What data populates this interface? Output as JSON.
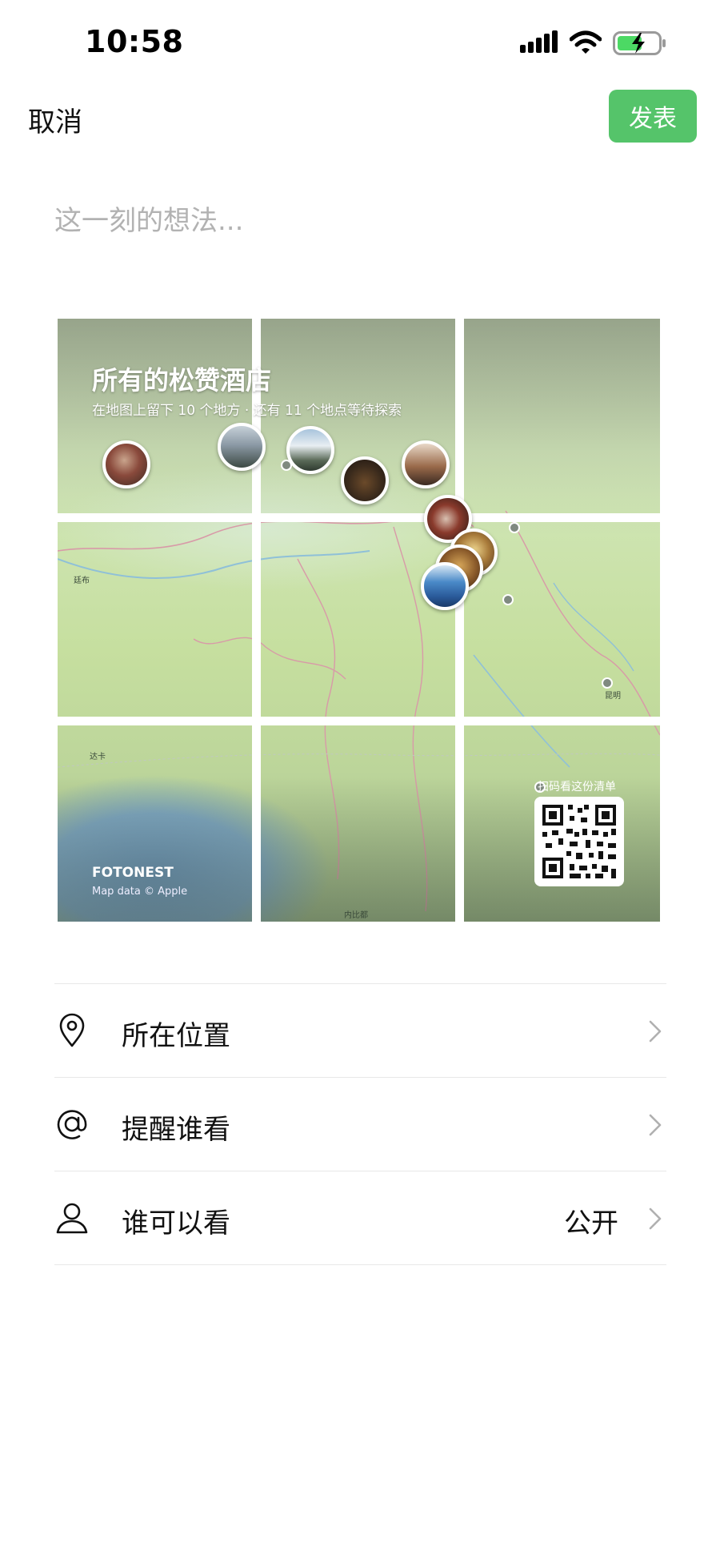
{
  "status_bar": {
    "time": "10:58"
  },
  "header": {
    "cancel_label": "取消",
    "publish_label": "发表"
  },
  "composer": {
    "placeholder": "这一刻的想法..."
  },
  "map_card": {
    "title": "所有的松赞酒店",
    "subtitle": "在地图上留下 10 个地方 · 还有 11 个地点等待探索",
    "place_labels": [
      "廷布",
      "昆明",
      "达卡",
      "内比都"
    ],
    "brand": "FOTONEST",
    "attribution": "Map data © Apple",
    "qr_caption": "扫码看这份清单"
  },
  "options": [
    {
      "icon": "location-pin-icon",
      "label": "所在位置",
      "value": ""
    },
    {
      "icon": "at-sign-icon",
      "label": "提醒谁看",
      "value": ""
    },
    {
      "icon": "person-icon",
      "label": "谁可以看",
      "value": "公开"
    }
  ],
  "colors": {
    "accent": "#55c46a",
    "placeholder": "#b2b2b2",
    "divider": "#e8e8e8"
  }
}
